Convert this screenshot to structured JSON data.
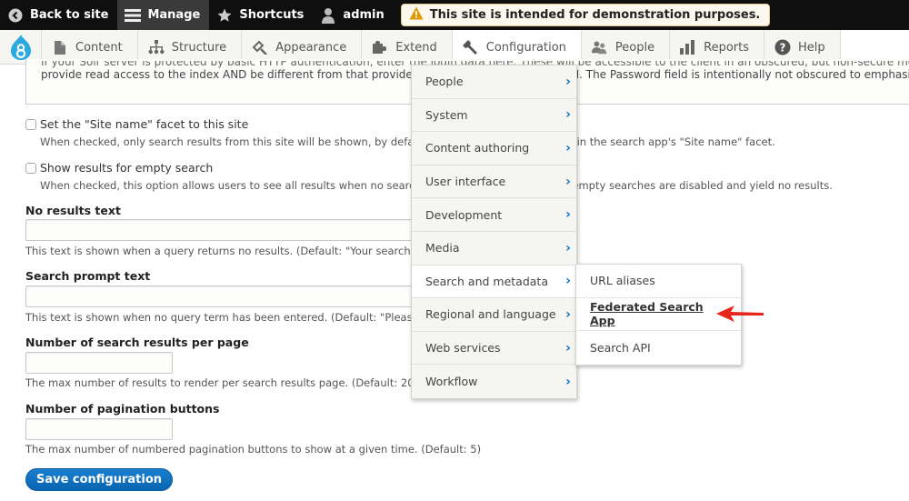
{
  "toolbar": {
    "back_to_site": "Back to site",
    "manage": "Manage",
    "shortcuts": "Shortcuts",
    "user": "admin",
    "notice": "This site is intended for demonstration purposes."
  },
  "tray": {
    "items": [
      {
        "label": "Content",
        "icon": "page-icon"
      },
      {
        "label": "Structure",
        "icon": "sitemap-icon"
      },
      {
        "label": "Appearance",
        "icon": "paintbrush-icon"
      },
      {
        "label": "Extend",
        "icon": "puzzle-icon"
      },
      {
        "label": "Configuration",
        "icon": "wrench-icon"
      },
      {
        "label": "People",
        "icon": "people-icon"
      },
      {
        "label": "Reports",
        "icon": "bar-chart-icon"
      },
      {
        "label": "Help",
        "icon": "help-icon"
      }
    ]
  },
  "form": {
    "auth_text_line1": "If your Solr server is protected by basic HTTP authentication, enter the login data here. These will be accessible to the client in an obscured, but non-secure method. It should,",
    "auth_text_line2": "provide read access to the index AND be different from that provided when configuring Search API. The Password field is intentionally not obscured to emphasize",
    "site_name_facet": {
      "label": "Set the \"Site name\" facet to this site",
      "checked": false,
      "description": "When checked, only search results from this site will be shown, by default, until this site is unchecked in the search app's \"Site name\" facet."
    },
    "show_empty": {
      "label": "Show results for empty search",
      "checked": false,
      "description": "When checked, this option allows users to see all results when no search term is entered. By default, empty searches are disabled and yield no results."
    },
    "no_results": {
      "label": "No results text",
      "value": "",
      "description": "This text is shown when a query returns no results. (Default: \"Your search yie"
    },
    "search_prompt": {
      "label": "Search prompt text",
      "value": "",
      "description": "This text is shown when no query term has been entered. (Default: \"Please en"
    },
    "results_per_page": {
      "label": "Number of search results per page",
      "value": "",
      "description": "The max number of results to render per search results page. (Default: 20)"
    },
    "pagination_buttons": {
      "label": "Number of pagination buttons",
      "value": "",
      "description": "The max number of numbered pagination buttons to show at a given time. (Default: 5)"
    },
    "save_label": "Save configuration",
    "visible_fragments": {
      "auth_right": "API. The Password field is intentionally not obscured to emphasize",
      "facet_right": "ecked in the search app's \"Site name\" facet.",
      "empty_right": "searches are disabled and yield no results."
    }
  },
  "config_menu": {
    "items": [
      {
        "label": "People"
      },
      {
        "label": "System"
      },
      {
        "label": "Content authoring"
      },
      {
        "label": "User interface"
      },
      {
        "label": "Development"
      },
      {
        "label": "Media"
      },
      {
        "label": "Search and metadata"
      },
      {
        "label": "Regional and language"
      },
      {
        "label": "Web services"
      },
      {
        "label": "Workflow"
      }
    ],
    "hovered": "Search and metadata"
  },
  "submenu": {
    "items": [
      {
        "label": "URL aliases"
      },
      {
        "label": "Federated Search App"
      },
      {
        "label": "Search API"
      }
    ],
    "highlighted": "Federated Search App"
  },
  "colors": {
    "brand_blue": "#0865b2",
    "chevron_blue": "#0a6fc2",
    "annotation_arrow": "#e8261b",
    "toolbar_bg": "#0f0f0f"
  }
}
